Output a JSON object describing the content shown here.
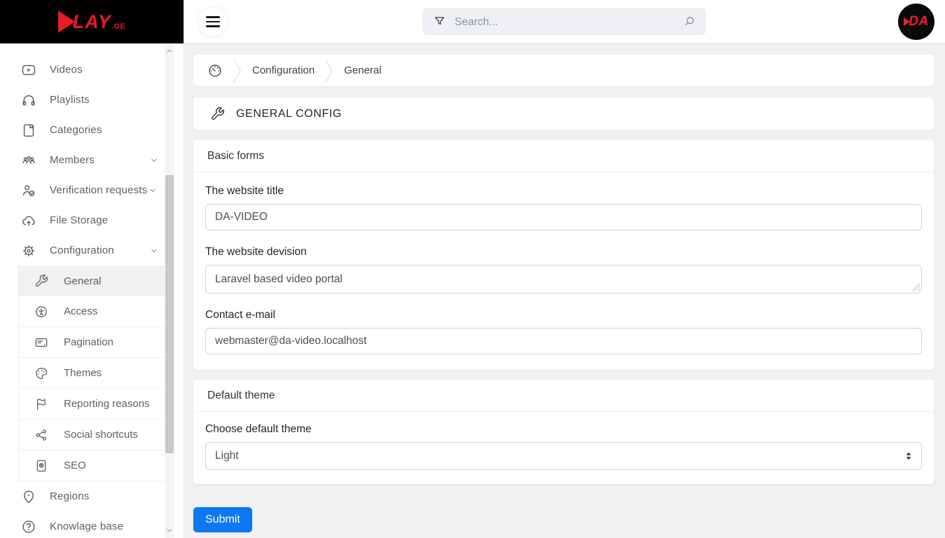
{
  "brand": {
    "logo_word": "LAY",
    "logo_tld": ".GE",
    "avatar_text": "DA",
    "accent_red": "#ec1a23"
  },
  "topbar": {
    "search_placeholder": "Search...",
    "icons": {
      "menu": "hamburger",
      "filter": "funnel",
      "search": "magnifier"
    }
  },
  "sidebar": {
    "items": [
      {
        "label": "Videos",
        "icon": "video-play"
      },
      {
        "label": "Playlists",
        "icon": "headphones"
      },
      {
        "label": "Categories",
        "icon": "journal-bookmark"
      },
      {
        "label": "Members",
        "icon": "people-group",
        "expandable": true
      },
      {
        "label": "Verification requests",
        "icon": "person-check",
        "expandable": true
      },
      {
        "label": "File Storage",
        "icon": "cloud-upload"
      },
      {
        "label": "Configuration",
        "icon": "gear",
        "expandable": true,
        "expanded": true
      }
    ],
    "config_submenu": [
      {
        "label": "General",
        "icon": "wrench",
        "active": true
      },
      {
        "label": "Access",
        "icon": "accessibility",
        "active": false
      },
      {
        "label": "Pagination",
        "icon": "card-lines",
        "active": false
      },
      {
        "label": "Themes",
        "icon": "palette",
        "active": false
      },
      {
        "label": "Reporting reasons",
        "icon": "flag",
        "active": false
      },
      {
        "label": "Social shortcuts",
        "icon": "share-nodes",
        "active": false
      },
      {
        "label": "SEO",
        "icon": "journal-arrow",
        "active": false
      }
    ],
    "bottom_items": [
      {
        "label": "Regions",
        "icon": "geo-pin"
      },
      {
        "label": "Knowlage base",
        "icon": "question-circle"
      }
    ]
  },
  "breadcrumb": {
    "home_icon": "speedometer",
    "item1": "Configuration",
    "item2": "General"
  },
  "page": {
    "title": "GENERAL CONFIG",
    "title_icon": "wrench"
  },
  "basic_forms": {
    "title": "Basic forms",
    "website_title": {
      "label": "The website title",
      "value": "DA-VIDEO"
    },
    "website_devision": {
      "label": "The website devision",
      "value": "Laravel based video portal"
    },
    "contact_email": {
      "label": "Contact e-mail",
      "value": "webmaster@da-video.localhost"
    }
  },
  "default_theme": {
    "title": "Default theme",
    "label": "Choose default theme",
    "value": "Light"
  },
  "actions": {
    "submit_label": "Submit",
    "submit_color": "#0d78f2"
  }
}
